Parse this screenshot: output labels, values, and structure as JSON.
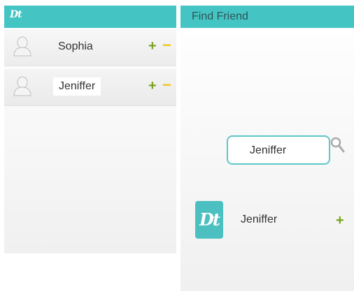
{
  "left_panel": {
    "logo": "Dt",
    "contacts": [
      {
        "name": "Sophia",
        "add_symbol": "+",
        "remove_symbol": "−",
        "avatar_icon": "user-silhouette-icon"
      },
      {
        "name": "Jeniffer",
        "add_symbol": "+",
        "remove_symbol": "−",
        "avatar_icon": "user-silhouette-icon"
      }
    ]
  },
  "right_panel": {
    "title": "Find Friend",
    "search": {
      "value": "Jeniffer",
      "icon": "magnifier-icon"
    },
    "result": {
      "logo": "Dt",
      "name": "Jeniffer",
      "add_symbol": "+"
    }
  },
  "colors": {
    "header": "#45c4c4",
    "add": "#78a51d",
    "remove": "#f0c419",
    "search_border": "#5ec7c7"
  }
}
